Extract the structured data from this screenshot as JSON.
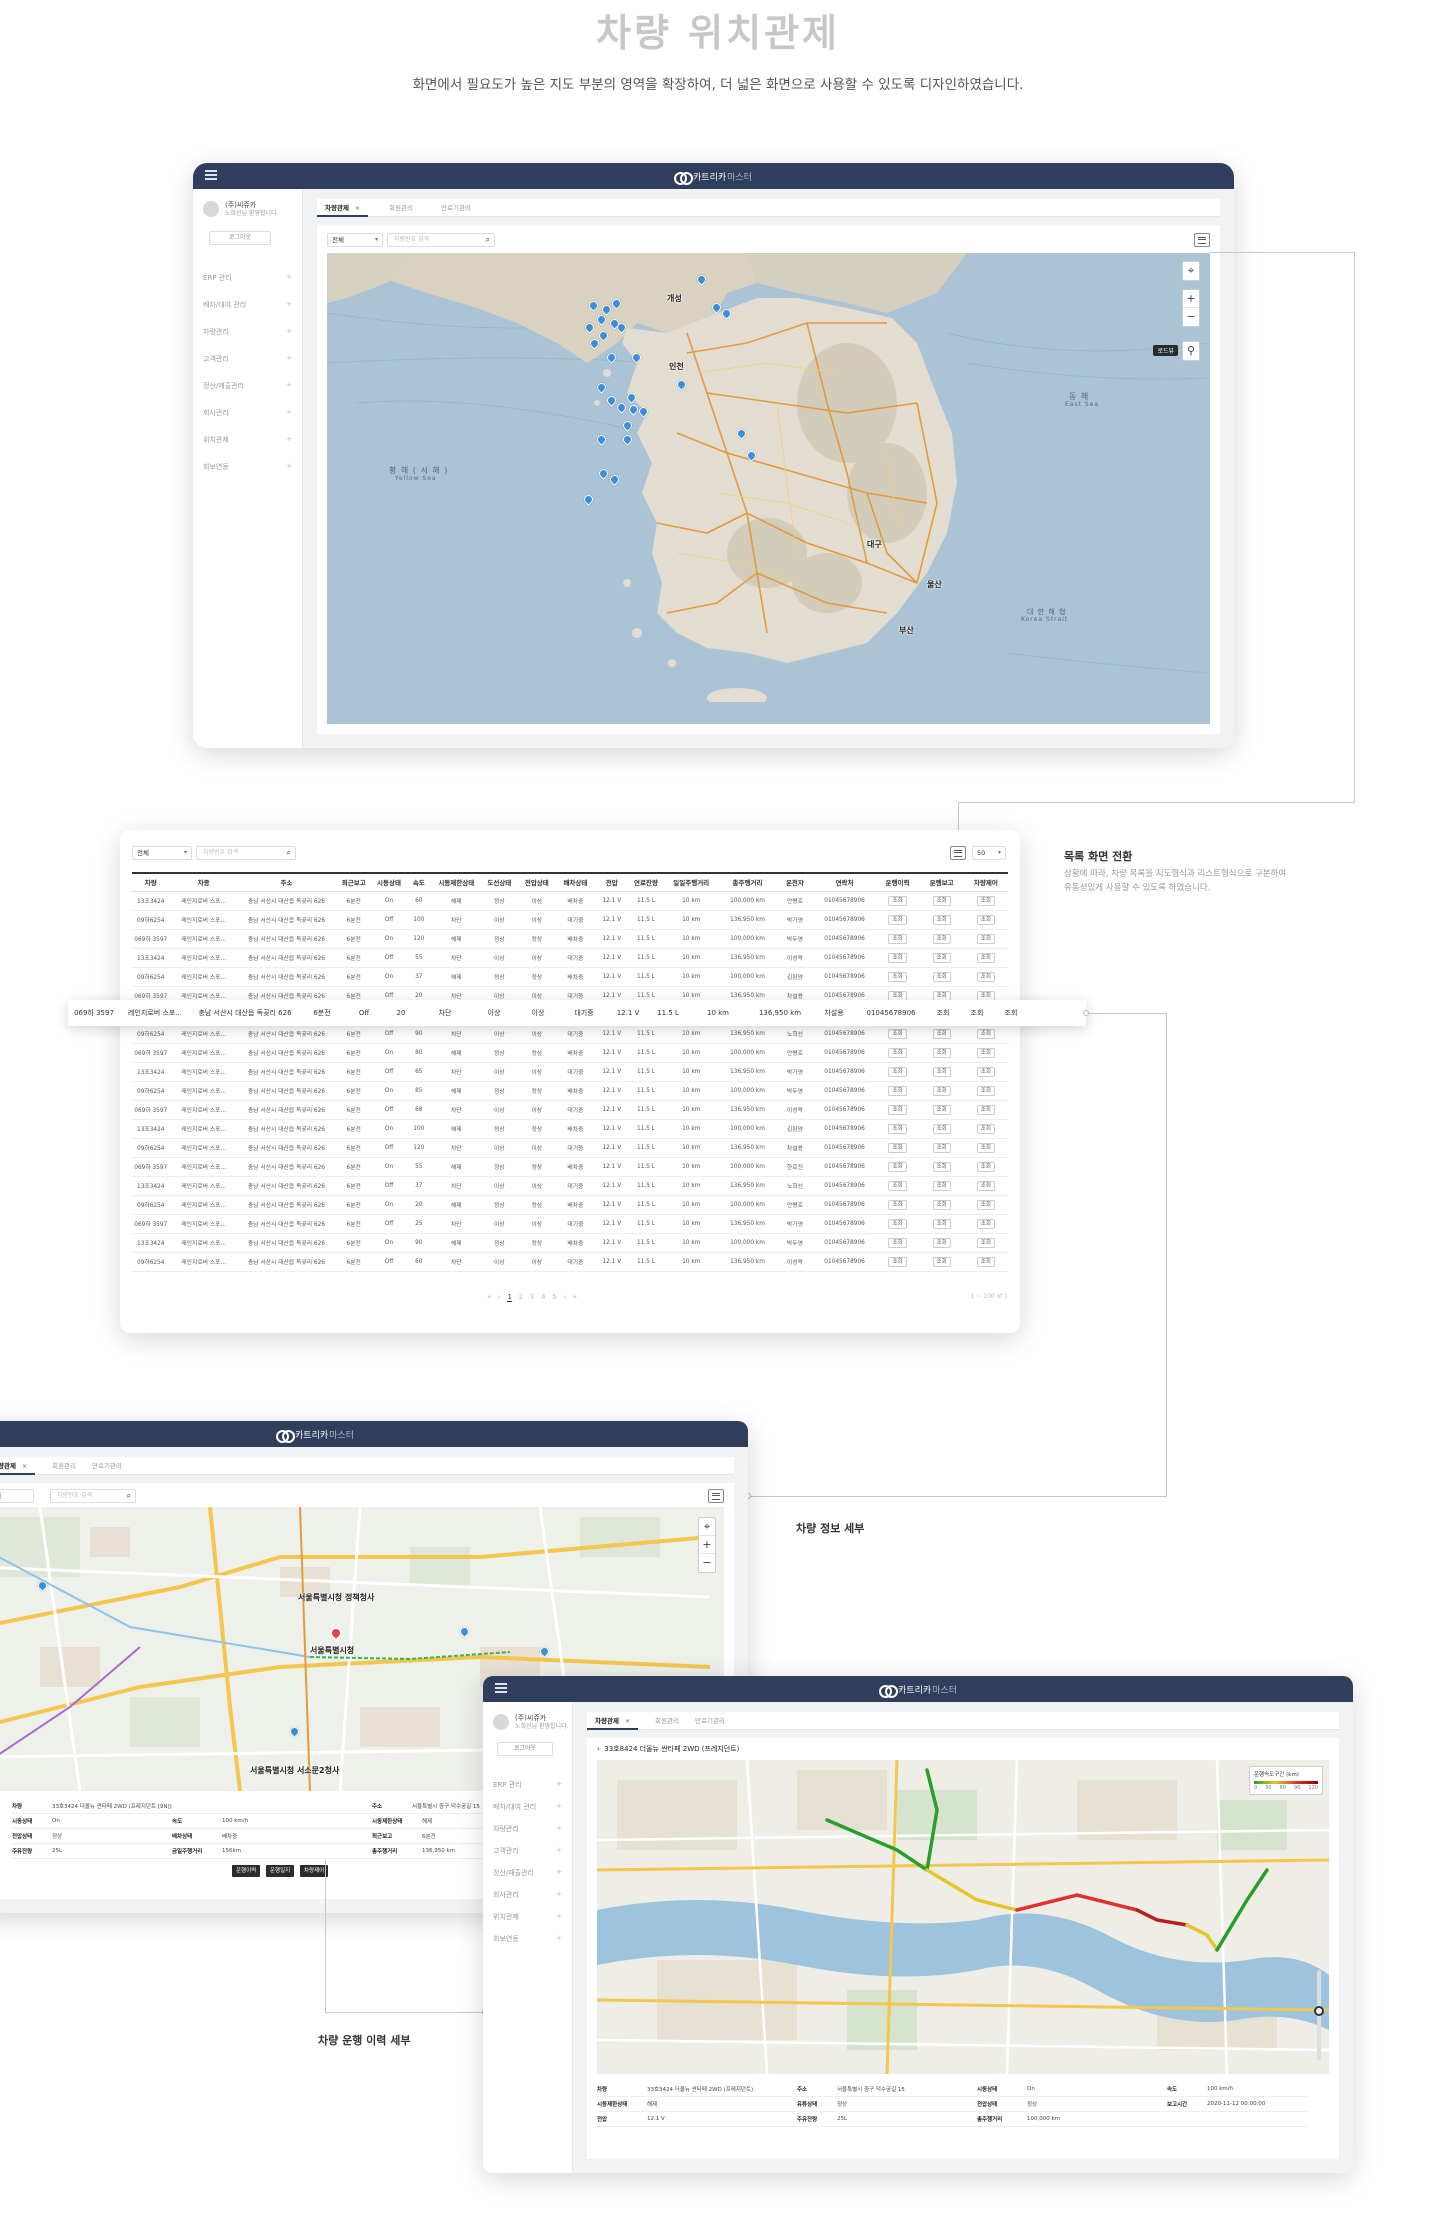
{
  "page": {
    "title": "차량 위치관제",
    "subtitle": "화면에서 필요도가 높은 지도 부분의 영역을 확장하여, 더 넓은 화면으로 사용할 수 있도록 디자인하였습니다."
  },
  "brand": {
    "name": "카트리카",
    "suffix": "마스터"
  },
  "profile": {
    "name": "(주)씨쥬카",
    "greeting": "노희선님 환영합니다.",
    "logout": "로그아웃"
  },
  "sidebar": {
    "items": [
      {
        "label": "ERP 관리"
      },
      {
        "label": "배차/대여 관리"
      },
      {
        "label": "차량관리"
      },
      {
        "label": "고객관리"
      },
      {
        "label": "정산/매출관리"
      },
      {
        "label": "회사관리"
      },
      {
        "label": "위치관제"
      },
      {
        "label": "회보연동"
      }
    ]
  },
  "tabs": [
    {
      "label": "차량관제"
    },
    {
      "label": "회원관리"
    },
    {
      "label": "만료기관리"
    }
  ],
  "filter": {
    "select": "전체",
    "search_placeholder": "차량번호 검색"
  },
  "map_korea": {
    "labels": {
      "yellow_sea": "황 해 ( 서 해 )",
      "yellow_sea_en": "Yellow Sea",
      "east_sea": "동 해",
      "east_sea_en": "East Sea",
      "korea_strait": "대 한 해 협",
      "korea_strait_en": "Korea Strait",
      "gaeseong": "개성",
      "incheon": "인천",
      "daegu": "대구",
      "ulsan": "울산",
      "busan": "부산"
    },
    "tooltip": "로드뷰"
  },
  "list_view": {
    "select": "전체",
    "search_placeholder": "차량번호 검색",
    "page_size": "50",
    "columns": [
      "차량",
      "차종",
      "주소",
      "최근보고",
      "시동상태",
      "속도",
      "시동제한상태",
      "도선상태",
      "전압상태",
      "배차상태",
      "전압",
      "연료잔량",
      "일일주행거리",
      "총주행거리",
      "운전자",
      "연락처",
      "운행이력",
      "운행보고",
      "차량제어"
    ],
    "rows": [
      [
        "13조3424",
        "레인지로버 스포...",
        "충남 서산시 대산읍 독곶리 626",
        "6분전",
        "On",
        "60",
        "해제",
        "정상",
        "이상",
        "배차중",
        "12.1 V",
        "11.5 L",
        "10 km",
        "100,000 km",
        "안병호",
        "01045678906",
        "조회",
        "조회",
        "조회"
      ],
      [
        "09하6254",
        "레인지로버 스포...",
        "충남 서산시 대산읍 독곶리 626",
        "6분전",
        "Off",
        "100",
        "차단",
        "이상",
        "이상",
        "대기중",
        "12.1 V",
        "11.5 L",
        "10 km",
        "136,950 km",
        "박가영",
        "01045678906",
        "조회",
        "조회",
        "조회"
      ],
      [
        "069하 3597",
        "레인지로버 스포...",
        "충남 서산시 대산읍 독곶리 626",
        "6분전",
        "On",
        "120",
        "해제",
        "정상",
        "정상",
        "배차중",
        "12.1 V",
        "11.5 L",
        "10 km",
        "100,000 km",
        "박두영",
        "01045678906",
        "조회",
        "조회",
        "조회"
      ],
      [
        "13조3424",
        "레인지로버 스포...",
        "충남 서산시 대산읍 독곶리 626",
        "6분전",
        "Off",
        "55",
        "차단",
        "이상",
        "이상",
        "대기중",
        "12.1 V",
        "11.5 L",
        "10 km",
        "136,950 km",
        "이성락",
        "01045678906",
        "조회",
        "조회",
        "조회"
      ],
      [
        "09하6254",
        "레인지로버 스포...",
        "충남 서산시 대산읍 독곶리 626",
        "6분전",
        "On",
        "37",
        "해제",
        "정상",
        "정상",
        "배차중",
        "12.1 V",
        "11.5 L",
        "10 km",
        "100,000 km",
        "김판양",
        "01045678906",
        "조회",
        "조회",
        "조회"
      ],
      [
        "069하 3597",
        "레인지로버 스포...",
        "충남 서산시 대산읍 독곶리 626",
        "6분전",
        "Off",
        "20",
        "차단",
        "이상",
        "이상",
        "대기중",
        "12.1 V",
        "11.5 L",
        "10 km",
        "136,950 km",
        "차설용",
        "01045678906",
        "조회",
        "조회",
        "조회"
      ],
      [
        "",
        "",
        "",
        "",
        "",
        "",
        "",
        "",
        "",
        "",
        "",
        "",
        "",
        "",
        "",
        "",
        "",
        "",
        ""
      ],
      [
        "09하6254",
        "레인지로버 스포...",
        "충남 서산시 대산읍 독곶리 626",
        "6분전",
        "Off",
        "90",
        "차단",
        "이상",
        "이상",
        "대기중",
        "12.1 V",
        "11.5 L",
        "10 km",
        "136,950 km",
        "노희선",
        "01045678906",
        "조회",
        "조회",
        "조회"
      ],
      [
        "069하 3597",
        "레인지로버 스포...",
        "충남 서산시 대산읍 독곶리 626",
        "6분전",
        "On",
        "80",
        "해제",
        "정상",
        "정상",
        "배차중",
        "12.1 V",
        "11.5 L",
        "10 km",
        "100,000 km",
        "안병호",
        "01045678906",
        "조회",
        "조회",
        "조회"
      ],
      [
        "13조3424",
        "레인지로버 스포...",
        "충남 서산시 대산읍 독곶리 626",
        "6분전",
        "Off",
        "65",
        "차단",
        "이상",
        "이상",
        "대기중",
        "12.1 V",
        "11.5 L",
        "10 km",
        "136,950 km",
        "박가영",
        "01045678906",
        "조회",
        "조회",
        "조회"
      ],
      [
        "09하6254",
        "레인지로버 스포...",
        "충남 서산시 대산읍 독곶리 626",
        "6분전",
        "On",
        "85",
        "해제",
        "정상",
        "정상",
        "배차중",
        "12.1 V",
        "11.5 L",
        "10 km",
        "100,000 km",
        "박두영",
        "01045678906",
        "조회",
        "조회",
        "조회"
      ],
      [
        "069하 3597",
        "레인지로버 스포...",
        "충남 서산시 대산읍 독곶리 626",
        "6분전",
        "Off",
        "68",
        "차단",
        "이상",
        "이상",
        "대기중",
        "12.1 V",
        "11.5 L",
        "10 km",
        "136,950 km",
        "이성락",
        "01045678906",
        "조회",
        "조회",
        "조회"
      ],
      [
        "13조3424",
        "레인지로버 스포...",
        "충남 서산시 대산읍 독곶리 626",
        "6분전",
        "On",
        "100",
        "해제",
        "정상",
        "정상",
        "배차중",
        "12.1 V",
        "11.5 L",
        "10 km",
        "100,000 km",
        "김판양",
        "01045678906",
        "조회",
        "조회",
        "조회"
      ],
      [
        "09하6254",
        "레인지로버 스포...",
        "충남 서산시 대산읍 독곶리 626",
        "6분전",
        "Off",
        "120",
        "차단",
        "이상",
        "이상",
        "대기중",
        "12.1 V",
        "11.5 L",
        "10 km",
        "136,950 km",
        "차설용",
        "01045678906",
        "조회",
        "조회",
        "조회"
      ],
      [
        "069하 3597",
        "레인지로버 스포...",
        "충남 서산시 대산읍 독곶리 626",
        "6분전",
        "On",
        "55",
        "해제",
        "정상",
        "정상",
        "배차중",
        "12.1 V",
        "11.5 L",
        "10 km",
        "100,000 km",
        "한호진",
        "01045678906",
        "조회",
        "조회",
        "조회"
      ],
      [
        "13조3424",
        "레인지로버 스포...",
        "충남 서산시 대산읍 독곶리 626",
        "6분전",
        "Off",
        "37",
        "차단",
        "이상",
        "이상",
        "대기중",
        "12.1 V",
        "11.5 L",
        "10 km",
        "136,950 km",
        "노희선",
        "01045678906",
        "조회",
        "조회",
        "조회"
      ],
      [
        "09하6254",
        "레인지로버 스포...",
        "충남 서산시 대산읍 독곶리 626",
        "6분전",
        "On",
        "20",
        "해제",
        "정상",
        "정상",
        "배차중",
        "12.1 V",
        "11.5 L",
        "10 km",
        "100,000 km",
        "안병호",
        "01045678906",
        "조회",
        "조회",
        "조회"
      ],
      [
        "069하 3597",
        "레인지로버 스포...",
        "충남 서산시 대산읍 독곶리 626",
        "6분전",
        "Off",
        "25",
        "차단",
        "이상",
        "이상",
        "대기중",
        "12.1 V",
        "11.5 L",
        "10 km",
        "136,950 km",
        "박가영",
        "01045678906",
        "조회",
        "조회",
        "조회"
      ],
      [
        "13조3424",
        "레인지로버 스포...",
        "충남 서산시 대산읍 독곶리 626",
        "6분전",
        "On",
        "90",
        "해제",
        "정상",
        "정상",
        "배차중",
        "12.1 V",
        "11.5 L",
        "10 km",
        "100,000 km",
        "박두영",
        "01045678906",
        "조회",
        "조회",
        "조회"
      ],
      [
        "09하6254",
        "레인지로버 스포...",
        "충남 서산시 대산읍 독곶리 626",
        "6분전",
        "Off",
        "60",
        "차단",
        "이상",
        "이상",
        "대기중",
        "12.1 V",
        "11.5 L",
        "10 km",
        "136,950 km",
        "이성락",
        "01045678906",
        "조회",
        "조회",
        "조회"
      ]
    ],
    "highlight_row": [
      "069하 3597",
      "레인지로버 스포...",
      "충남 서산시 대산읍 독곶리 626",
      "6분전",
      "Off",
      "20",
      "차단",
      "이상",
      "이상",
      "대기중",
      "12.1 V",
      "11.5 L",
      "10 km",
      "136,950 km",
      "차설용",
      "01045678906",
      "조회",
      "조회",
      "조회"
    ],
    "pager": {
      "first": "«",
      "prev": "‹",
      "pages": [
        "1",
        "2",
        "3",
        "4",
        "5"
      ],
      "next": "›",
      "last": "»",
      "summary": "1 ~ 100 of 1"
    }
  },
  "annotations": {
    "list_switch_title": "목록 화면 전환",
    "list_switch_desc1": "상황에 따라, 차량 목록을 지도형식과 리스트형식으로 구분하여",
    "list_switch_desc2": "유동성있게 사용할 수 있도록 하였습니다.",
    "vehicle_detail": "차량 정보 세부",
    "history_detail": "차량 운행 이력 세부"
  },
  "detail_view": {
    "map_labels": {
      "city_hall": "서울특별시청",
      "city_hall_annex": "서울특별시청 정책청사",
      "seosomun": "서울특별시청 서소문2청사"
    },
    "info": {
      "vehicle_k": "차량",
      "vehicle_v": "33호3424 더올뉴 싼타페 2WD (프레지던트 [9N])",
      "addr_k": "주소",
      "addr_v": "서울특별시 중구 덕수궁길 15",
      "ign_k": "시동상태",
      "ign_v": "On",
      "speed_k": "속도",
      "speed_v": "100 km/h",
      "limit_k": "시동제한상태",
      "limit_v": "해제",
      "volt_k": "전압상태",
      "volt_v": "정상",
      "dispatch_k": "배차상태",
      "dispatch_v": "배차중",
      "report_k": "최근보고",
      "report_v": "6분전",
      "fuel_k": "주유잔량",
      "fuel_v": "25L",
      "daily_k": "금일주행거리",
      "daily_v": "156km",
      "total_k": "총주행거리",
      "total_v": "136,950 km"
    },
    "buttons": [
      "운행이력",
      "운행일지",
      "차량제어"
    ]
  },
  "history_view": {
    "route_title": "33호8424 더올뉴 싼타페 2WD (프레지던트)",
    "legend_title": "운행속도구간 (km)",
    "legend_ticks": [
      "0",
      "30",
      "60",
      "90",
      "120"
    ],
    "info": {
      "vehicle_k": "차량",
      "vehicle_v": "33호3424 더올뉴 싼타페 2WD (프레지던트)",
      "addr_k": "주소",
      "addr_v": "서울특별시 중구 덕수궁길 15",
      "ign_k": "시동상태",
      "ign_v": "On",
      "speed_k": "속도",
      "speed_v": "100 km/h",
      "limit_k": "시동제한상태",
      "limit_v": "해제",
      "oil_k": "유류상태",
      "oil_v": "정상",
      "volt_k": "전압상태",
      "volt_v": "정상",
      "report_k": "보고시간",
      "report_v": "2020-11-12 00:00:00",
      "v_k": "전압",
      "v_v": "12.1 V",
      "fuel_k": "주유잔량",
      "fuel_v": "25L",
      "total_k": "총주행거리",
      "total_v": "100,000 km"
    }
  },
  "colors": {
    "topbar": "#2e3e5c",
    "marker": "#3b8fd8",
    "route_fast": "#2a9d2a",
    "route_slow": "#e03030"
  }
}
